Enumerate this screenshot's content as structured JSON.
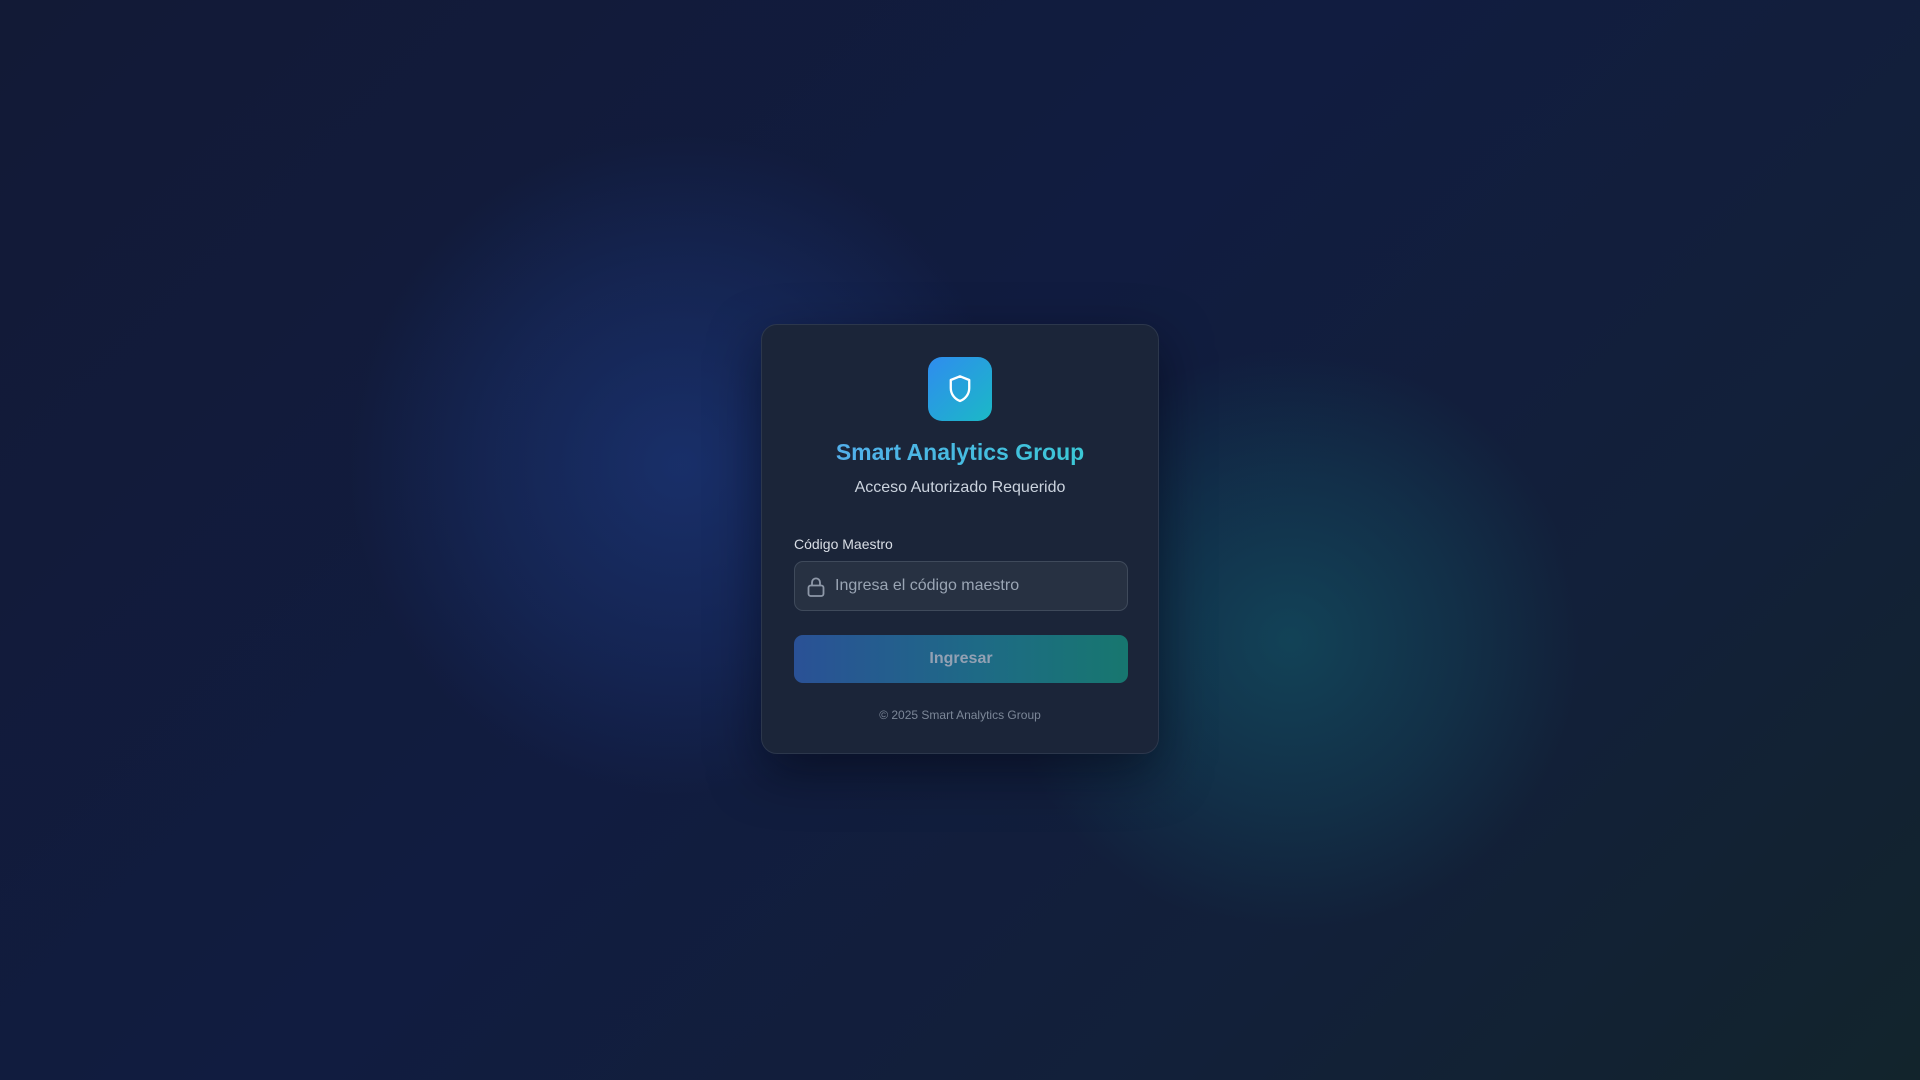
{
  "app": {
    "title": "Smart Analytics Group",
    "subtitle": "Acceso Autorizado Requerido",
    "logo_icon": "shield-icon"
  },
  "form": {
    "label": "Código Maestro",
    "input_icon": "lock-icon",
    "input_value": "",
    "input_placeholder": "Ingresa el código maestro",
    "submit_label": "Ingresar"
  },
  "footer": {
    "text": "© 2025 Smart Analytics Group"
  },
  "colors": {
    "accent_start": "#2f8cef",
    "accent_end": "#1bb9c6",
    "card_background": "#1b2539",
    "page_background": "#121c38"
  }
}
